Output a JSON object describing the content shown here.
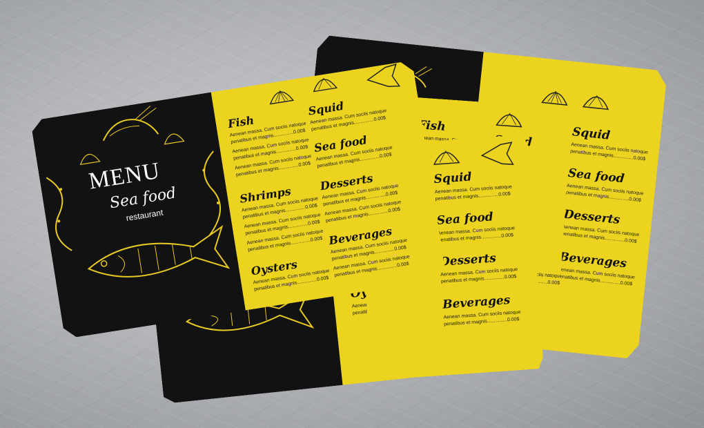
{
  "scene": {
    "background_color": "#b6b8bc",
    "menu_yellow": "#ecd31f",
    "menu_black": "#121212"
  },
  "menu": {
    "title": "MENU",
    "subtitle": "Sea food",
    "tagline": "restaurant"
  },
  "sections": {
    "fish": "Fish",
    "squid": "Squid",
    "shrimps": "Shrimps",
    "sea_food": "Sea food",
    "desserts": "Desserts",
    "beverages": "Beverages",
    "oysters": "Oysters"
  },
  "item": {
    "line1": "Aenean massa. Cum sociis natoque",
    "line2": "penatibus et magnis...............0.00$"
  }
}
